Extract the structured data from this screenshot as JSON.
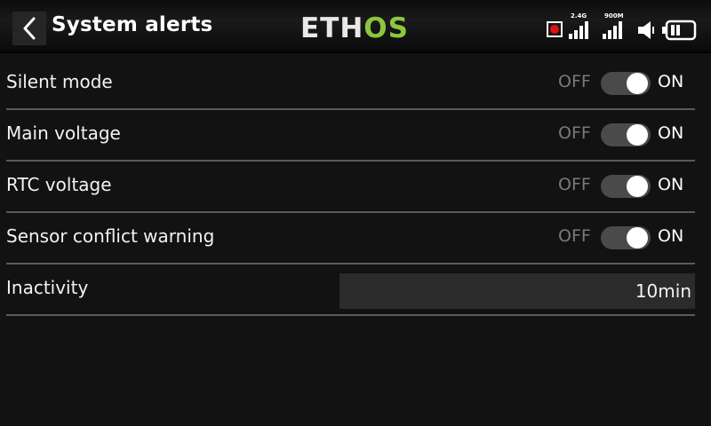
{
  "header": {
    "back_icon": "chevron-left-icon",
    "title": "System alerts",
    "logo": {
      "part1": "ETH",
      "part2": "OS"
    },
    "status": {
      "rec_icon": "record-icon",
      "signal1_label": "2.4G",
      "signal2_label": "900M",
      "speaker_icon": "speaker-icon",
      "battery_icon": "battery-icon"
    }
  },
  "colors": {
    "accent": "#8cc63f",
    "rec": "#e01010"
  },
  "toggle_text": {
    "off": "OFF",
    "on": "ON"
  },
  "rows": [
    {
      "label": "Silent mode",
      "state": "ON"
    },
    {
      "label": "Main voltage",
      "state": "ON"
    },
    {
      "label": "RTC voltage",
      "state": "ON"
    },
    {
      "label": "Sensor conflict warning",
      "state": "ON"
    }
  ],
  "inactivity": {
    "label": "Inactivity",
    "value": "10min"
  }
}
